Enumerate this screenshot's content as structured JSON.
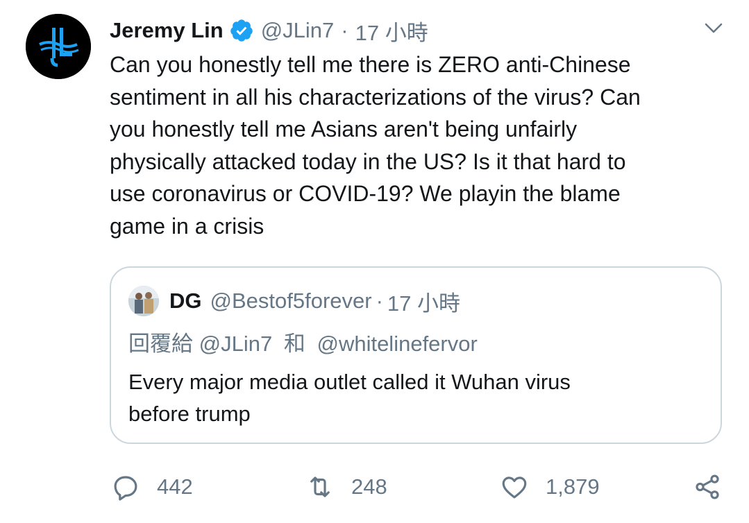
{
  "tweet": {
    "author_name": "Jeremy Lin",
    "handle": "@JLin7",
    "separator": "·",
    "time": "17 小時",
    "text": "Can you honestly tell me there is ZERO anti-Chinese\nsentiment in all his characterizations of the virus? Can\nyou honestly tell me Asians aren't being unfairly\nphysically attacked today in the US? Is it that hard to\nuse coronavirus or COVID-19? We playin the blame\ngame in a crisis"
  },
  "quoted": {
    "author_name": "DG",
    "handle": "@Bestof5forever",
    "separator": "·",
    "time": "17 小時",
    "reply_prefix": "回覆給",
    "reply_user1": "@JLin7",
    "reply_joiner": "和",
    "reply_user2": "@whitelinefervor",
    "text": "Every major media outlet called it Wuhan virus\nbefore trump"
  },
  "actions": {
    "reply_count": "442",
    "retweet_count": "248",
    "like_count": "1,879"
  },
  "icons": {
    "verified": "verified-badge-icon",
    "caret": "chevron-down-icon",
    "reply": "reply-icon",
    "retweet": "retweet-icon",
    "like": "heart-icon",
    "share": "share-icon"
  },
  "colors": {
    "verified_blue": "#1da1f2",
    "secondary_text": "#657786",
    "primary_text": "#14171a",
    "border": "#ccd6dd",
    "avatar_bg": "#000000",
    "logo_blue": "#1da1f2"
  }
}
